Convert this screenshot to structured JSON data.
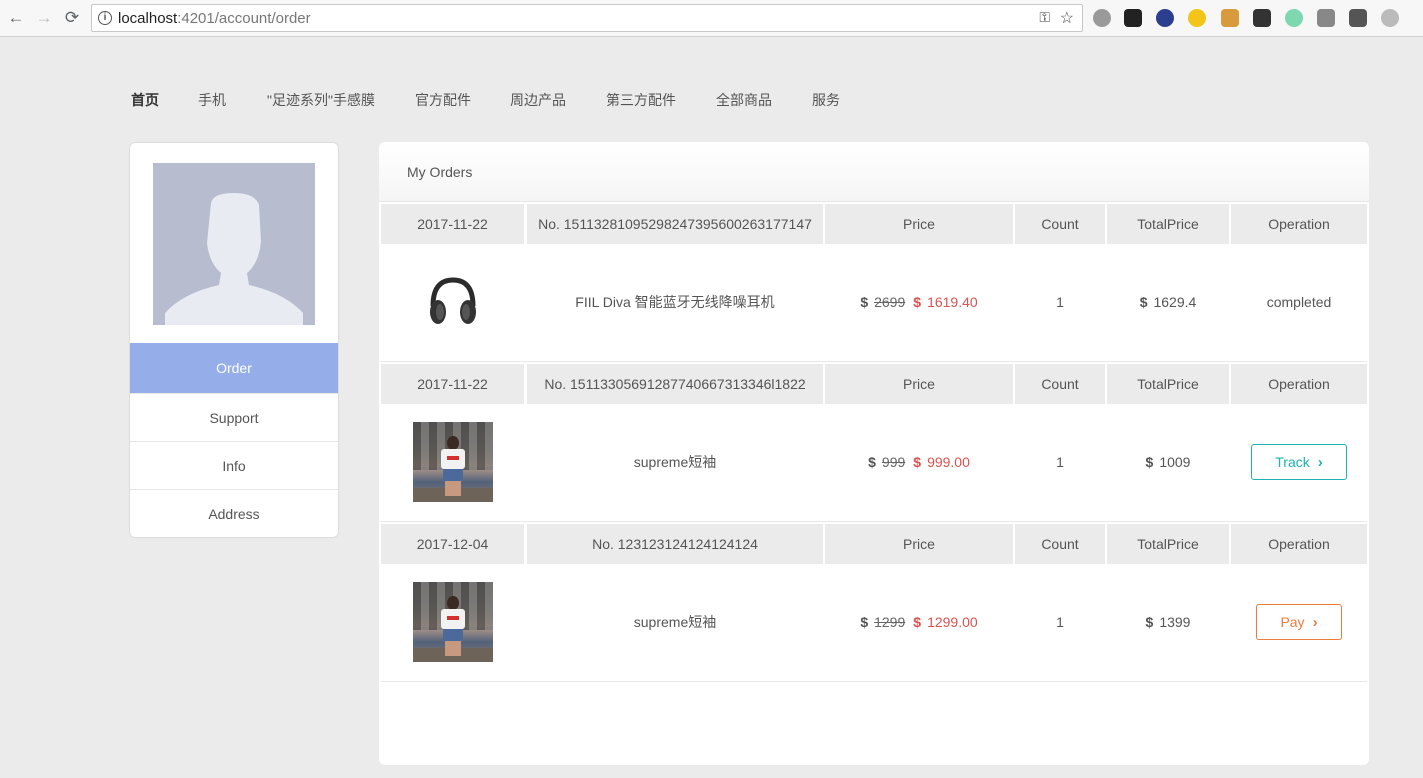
{
  "browser": {
    "url_host": "localhost",
    "url_path": ":4201/account/order"
  },
  "topnav": [
    "首页",
    "手机",
    "\"足迹系列\"手感膜",
    "官方配件",
    "周边产品",
    "第三方配件",
    "全部商品",
    "服务"
  ],
  "sidebar": {
    "items": [
      {
        "label": "Order"
      },
      {
        "label": "Support"
      },
      {
        "label": "Info"
      },
      {
        "label": "Address"
      }
    ]
  },
  "main": {
    "title": "My Orders",
    "headers": {
      "price": "Price",
      "count": "Count",
      "total": "TotalPrice",
      "operation": "Operation"
    },
    "currency": "$",
    "orders": [
      {
        "date": "2017-11-22",
        "number": "No. 15113281095298247395600263177147",
        "product": "FIIL Diva 智能蓝牙无线降噪耳机",
        "image": "headphones",
        "original_price": "2699",
        "sale_price": "1619.40",
        "count": "1",
        "total": "1629.4",
        "operation": "completed"
      },
      {
        "date": "2017-11-22",
        "number": "No. 15113305691287740667313346l1822",
        "product": "supreme短袖",
        "image": "photo",
        "original_price": "999",
        "sale_price": "999.00",
        "count": "1",
        "total": "1009",
        "operation": "Track"
      },
      {
        "date": "2017-12-04",
        "number": "No. 123123124124124124",
        "product": "supreme短袖",
        "image": "photo",
        "original_price": "1299",
        "sale_price": "1299.00",
        "count": "1",
        "total": "1399",
        "operation": "Pay"
      }
    ]
  },
  "colors": {
    "accent_sidebar": "#95aee9",
    "sale_red": "#d9534f",
    "track_teal": "#1bb3b3",
    "pay_orange": "#ec7b3c"
  }
}
